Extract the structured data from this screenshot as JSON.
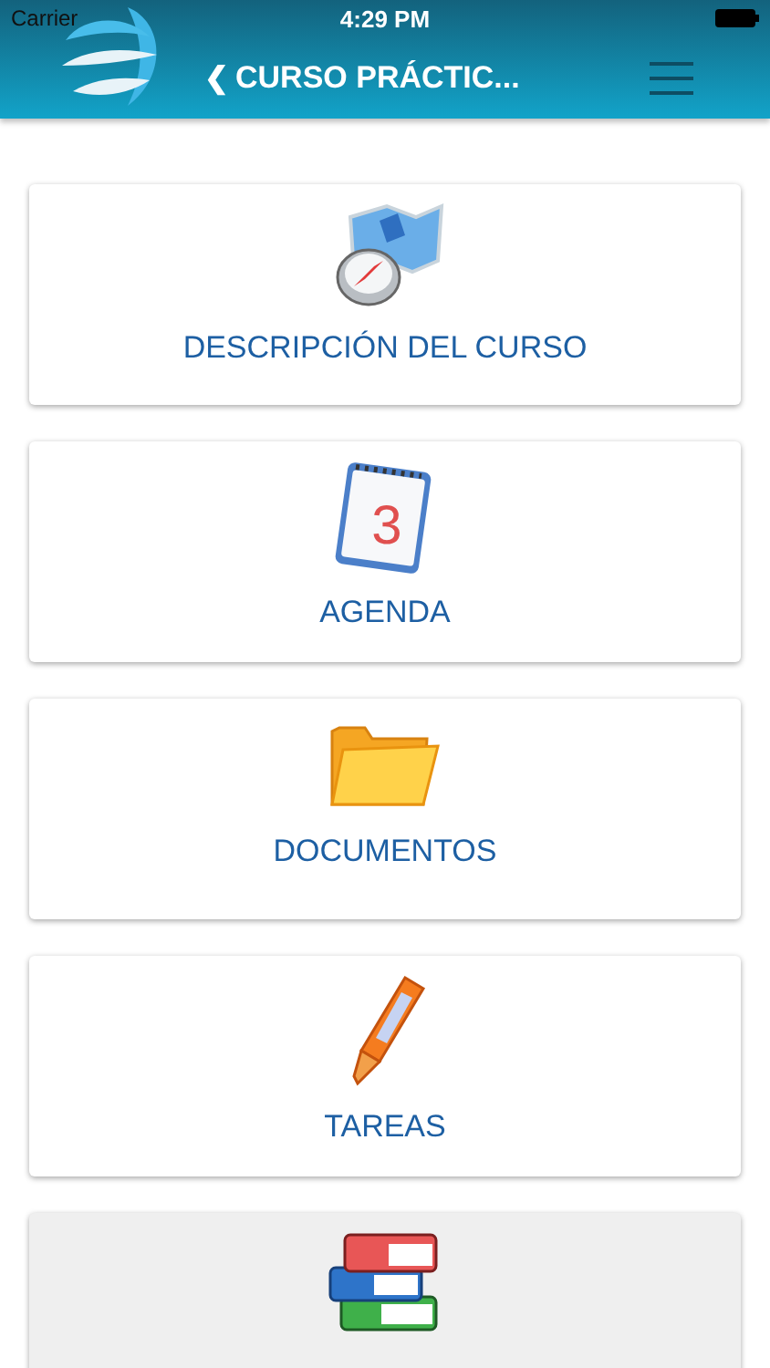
{
  "status_bar": {
    "carrier": "Carrier",
    "time": "4:29 PM"
  },
  "header": {
    "back_icon": "❮",
    "title": "CURSO PRÁCTIC..."
  },
  "menu": [
    {
      "kind": "compass",
      "label": "DESCRIPCIÓN DEL CURSO",
      "selected": false
    },
    {
      "kind": "calendar",
      "label": "AGENDA",
      "day": "3",
      "selected": false
    },
    {
      "kind": "folder",
      "label": "DOCUMENTOS",
      "selected": false
    },
    {
      "kind": "pen",
      "label": "TAREAS",
      "selected": false
    },
    {
      "kind": "books",
      "selected": true
    }
  ]
}
